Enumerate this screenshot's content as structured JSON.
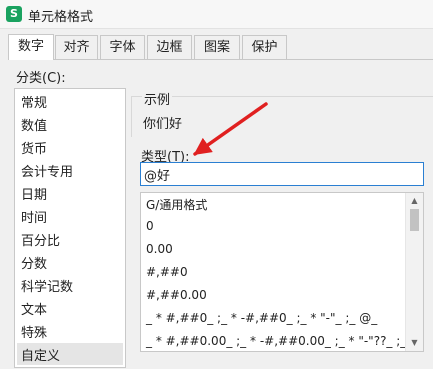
{
  "window": {
    "icon_letter": "S",
    "title": "单元格格式"
  },
  "tabs": [
    "数字",
    "对齐",
    "字体",
    "边框",
    "图案",
    "保护"
  ],
  "category": {
    "label": "分类(C):",
    "items": [
      "常规",
      "数值",
      "货币",
      "会计专用",
      "日期",
      "时间",
      "百分比",
      "分数",
      "科学记数",
      "文本",
      "特殊",
      "自定义"
    ],
    "selected": "自定义"
  },
  "sample": {
    "label": "示例",
    "value": "你们好"
  },
  "type": {
    "label": "类型(T):",
    "value": "@好"
  },
  "formats": [
    "G/通用格式",
    "0",
    "0.00",
    "#,##0",
    "#,##0.00",
    "_ * #,##0_ ;_ * -#,##0_ ;_ * \"-\"_ ;_ @_",
    "_ * #,##0.00_ ;_ * -#,##0.00_ ;_ * \"-\"??_ ;_ @_"
  ],
  "colors": {
    "annotation_arrow": "#e02020",
    "input_focus": "#2a7fd2",
    "app_icon": "#1aa260"
  }
}
